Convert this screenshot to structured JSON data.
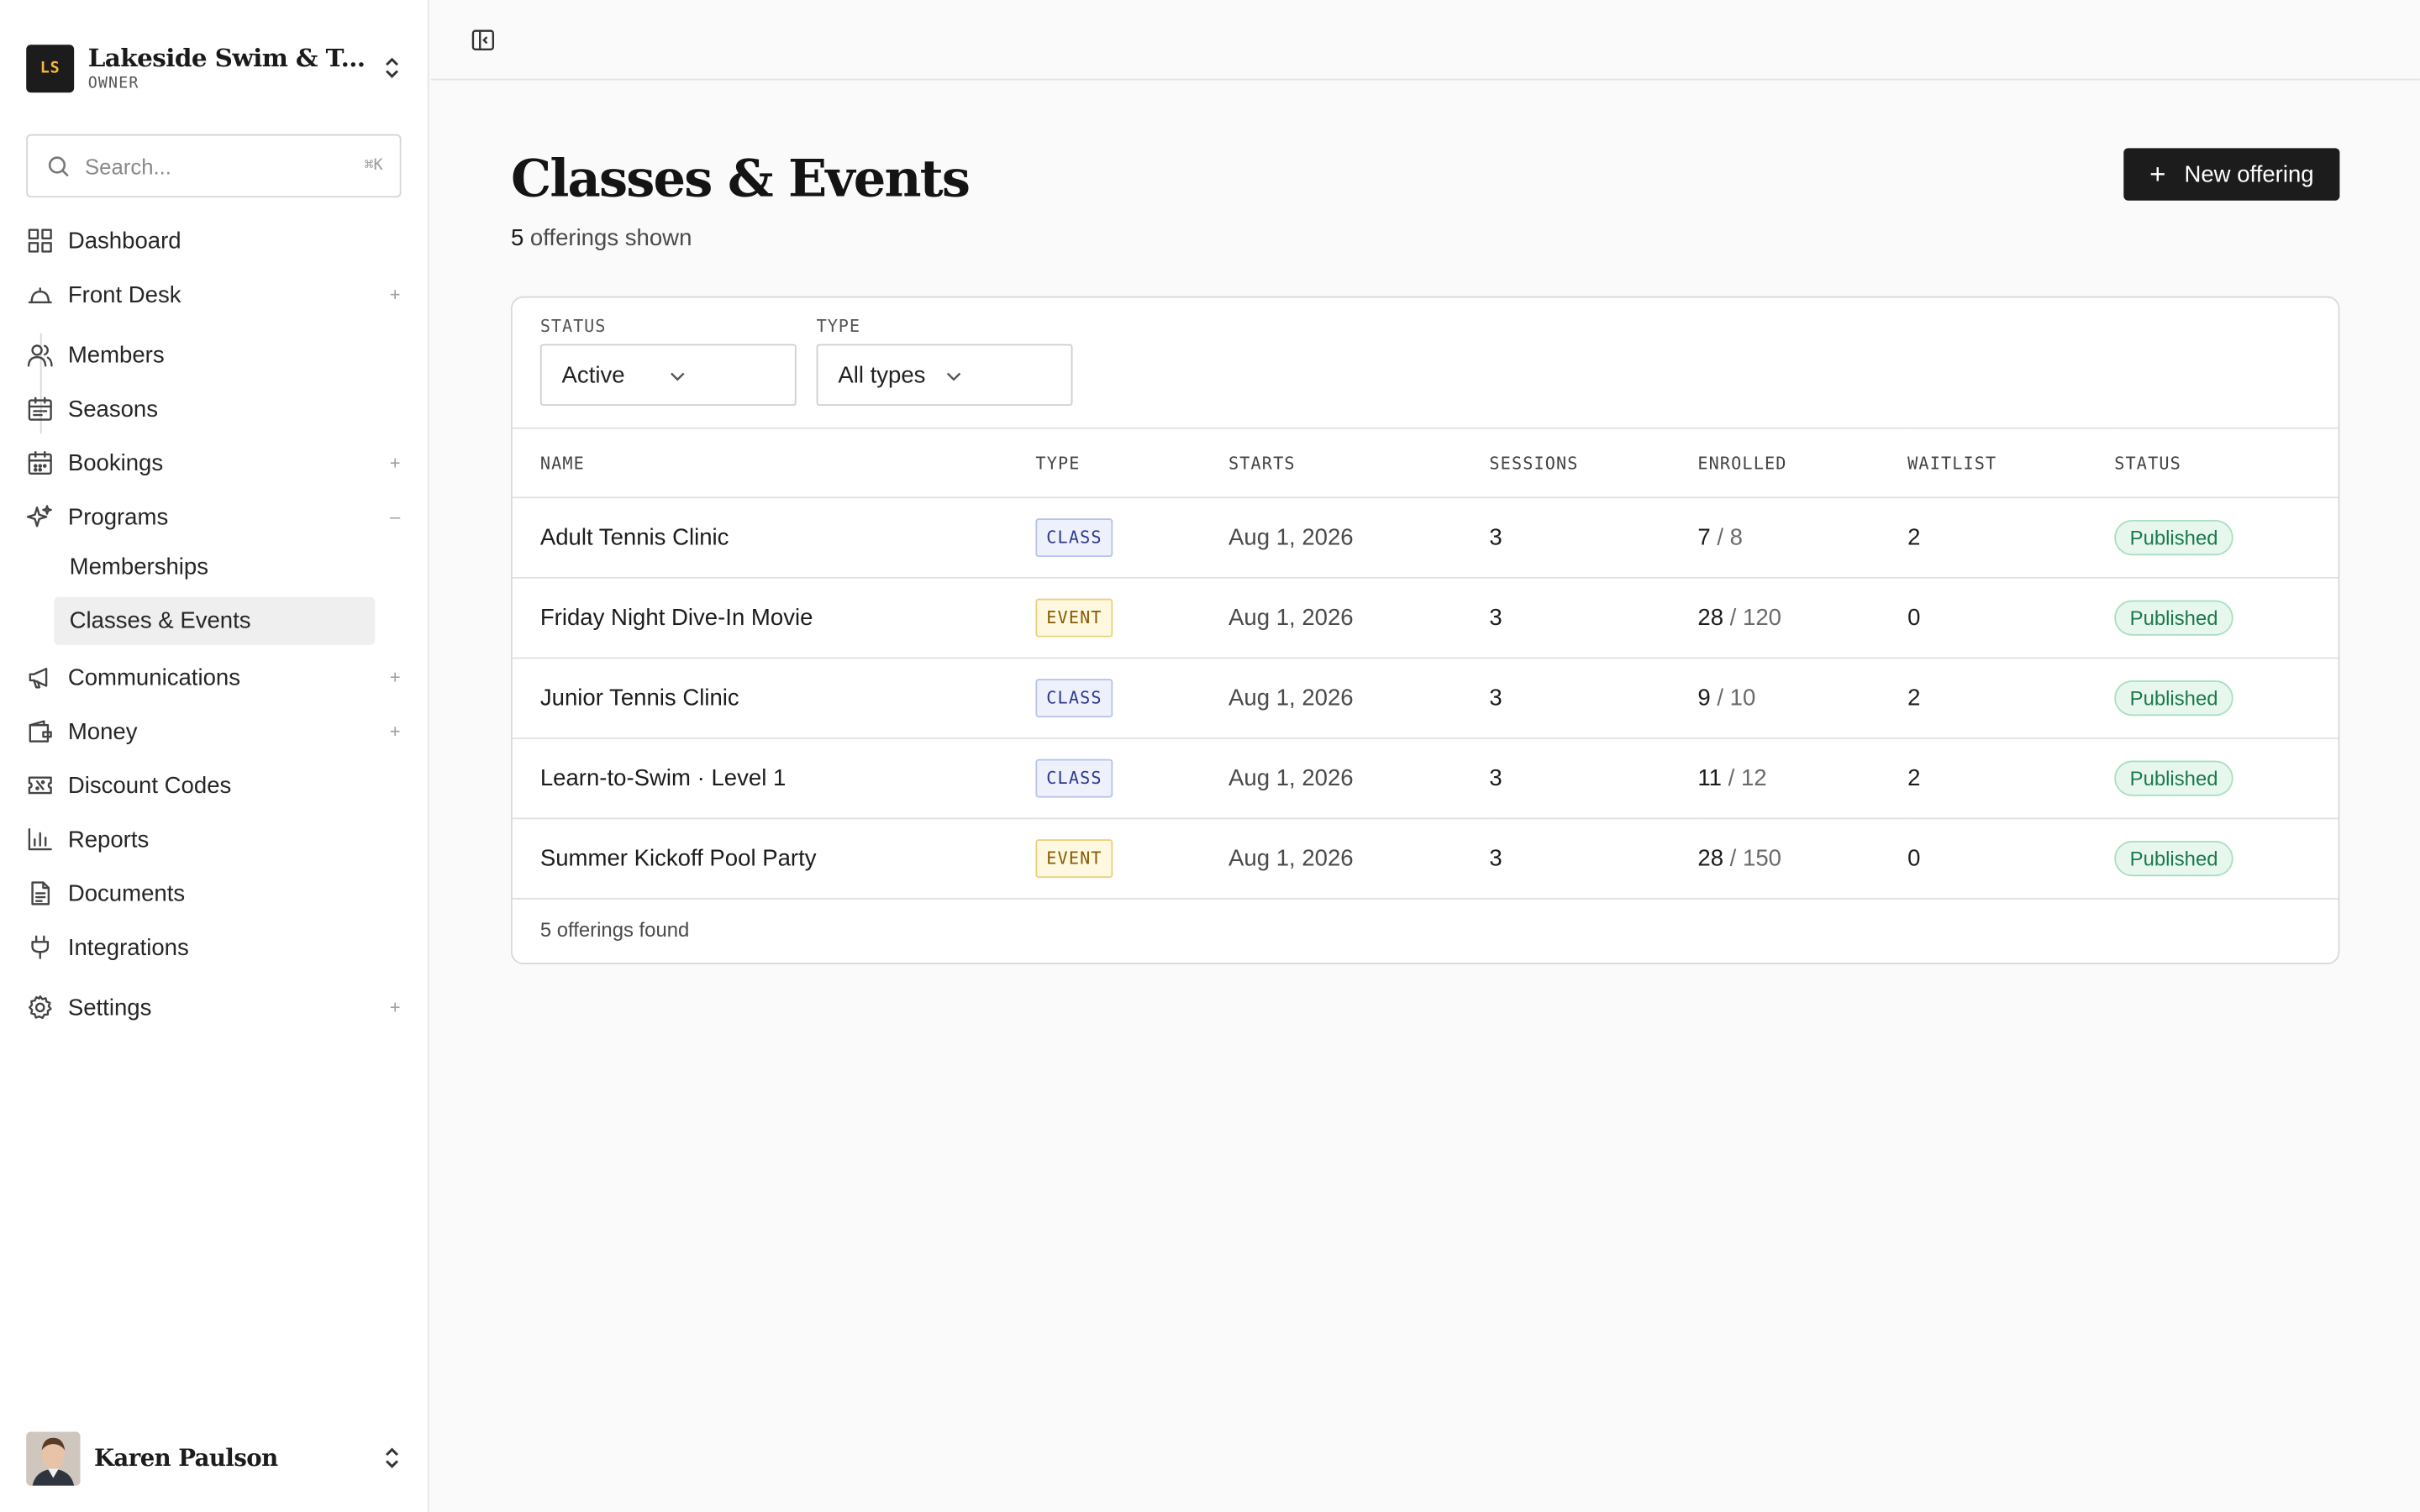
{
  "org": {
    "initials": "LS",
    "name": "Lakeside Swim & Ten...",
    "role": "OWNER"
  },
  "search": {
    "placeholder": "Search...",
    "shortcut": "⌘K"
  },
  "nav": {
    "items": [
      {
        "label": "Dashboard",
        "icon": "dashboard-icon",
        "expand": ""
      },
      {
        "label": "Front Desk",
        "icon": "bell-icon",
        "expand": "+"
      },
      {
        "label": "Members",
        "icon": "users-icon",
        "expand": ""
      },
      {
        "label": "Seasons",
        "icon": "calendar-icon",
        "expand": ""
      },
      {
        "label": "Bookings",
        "icon": "calendar-grid-icon",
        "expand": "+"
      },
      {
        "label": "Programs",
        "icon": "sparkles-icon",
        "expand": "–"
      },
      {
        "label": "Communications",
        "icon": "megaphone-icon",
        "expand": "+"
      },
      {
        "label": "Money",
        "icon": "wallet-icon",
        "expand": "+"
      },
      {
        "label": "Discount Codes",
        "icon": "ticket-icon",
        "expand": ""
      },
      {
        "label": "Reports",
        "icon": "bar-chart-icon",
        "expand": ""
      },
      {
        "label": "Documents",
        "icon": "document-icon",
        "expand": ""
      },
      {
        "label": "Integrations",
        "icon": "plug-icon",
        "expand": ""
      },
      {
        "label": "Settings",
        "icon": "gear-icon",
        "expand": "+"
      }
    ],
    "sub_items": [
      {
        "label": "Memberships"
      },
      {
        "label": "Classes & Events"
      }
    ]
  },
  "user": {
    "name": "Karen Paulson"
  },
  "page": {
    "title": "Classes & Events",
    "count": "5",
    "count_suffix": "offerings shown",
    "new_button": "New offering"
  },
  "filters": {
    "status_label": "STATUS",
    "status_value": "Active",
    "type_label": "TYPE",
    "type_value": "All types"
  },
  "table": {
    "headers": [
      "NAME",
      "TYPE",
      "STARTS",
      "SESSIONS",
      "ENROLLED",
      "WAITLIST",
      "STATUS"
    ],
    "rows": [
      {
        "name": "Adult Tennis Clinic",
        "type": "CLASS",
        "starts": "Aug 1, 2026",
        "sessions": "3",
        "enrolled": "7",
        "capacity": "/ 8",
        "waitlist": "2",
        "status": "Published"
      },
      {
        "name": "Friday Night Dive-In Movie",
        "type": "EVENT",
        "starts": "Aug 1, 2026",
        "sessions": "3",
        "enrolled": "28",
        "capacity": "/ 120",
        "waitlist": "0",
        "status": "Published"
      },
      {
        "name": "Junior Tennis Clinic",
        "type": "CLASS",
        "starts": "Aug 1, 2026",
        "sessions": "3",
        "enrolled": "9",
        "capacity": "/ 10",
        "waitlist": "2",
        "status": "Published"
      },
      {
        "name": "Learn-to-Swim · Level 1",
        "type": "CLASS",
        "starts": "Aug 1, 2026",
        "sessions": "3",
        "enrolled": "11",
        "capacity": "/ 12",
        "waitlist": "2",
        "status": "Published"
      },
      {
        "name": "Summer Kickoff Pool Party",
        "type": "EVENT",
        "starts": "Aug 1, 2026",
        "sessions": "3",
        "enrolled": "28",
        "capacity": "/ 150",
        "waitlist": "0",
        "status": "Published"
      }
    ],
    "footer": "5 offerings found"
  },
  "colors": {
    "accent": "#1c1c1c",
    "logo_text": "#f5b83d",
    "published": "#1a7a4a",
    "class_badge": "#2d3a8c",
    "event_badge": "#8a5a00"
  }
}
